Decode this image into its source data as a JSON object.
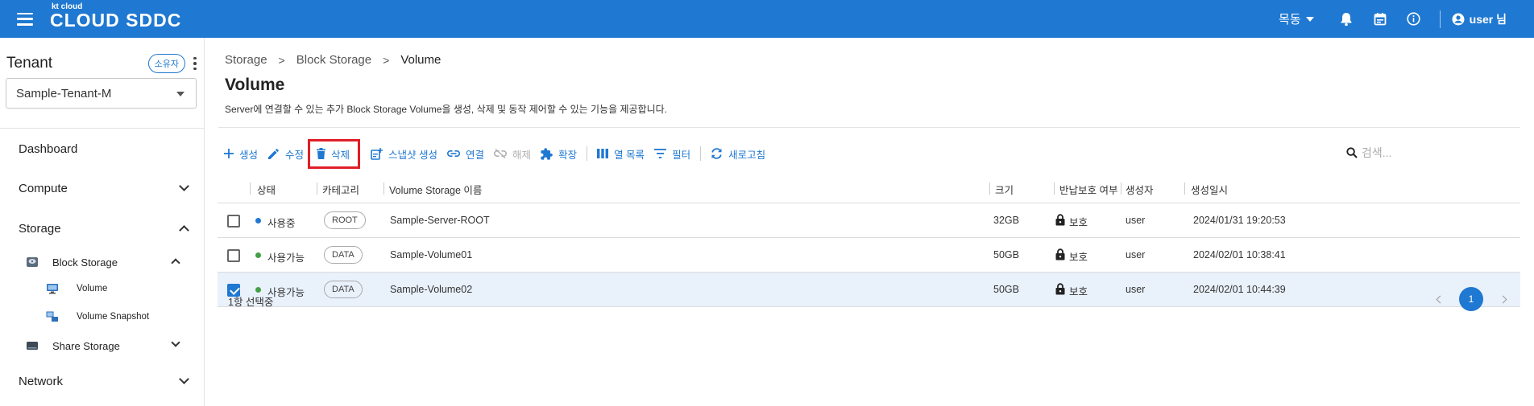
{
  "header": {
    "logo_small": "kt cloud",
    "logo_main": "CLOUD SDDC",
    "lang": "목동",
    "user": "user 님"
  },
  "sidebar": {
    "tenant_title": "Tenant",
    "owner_badge": "소유자",
    "tenant_select": "Sample-Tenant-M",
    "items": {
      "dashboard": "Dashboard",
      "compute": "Compute",
      "storage": "Storage",
      "block_storage": "Block Storage",
      "volume": "Volume",
      "volume_snapshot": "Volume Snapshot",
      "share_storage": "Share Storage",
      "network": "Network"
    }
  },
  "breadcrumb": {
    "items": [
      "Storage",
      "Block Storage",
      "Volume"
    ]
  },
  "page": {
    "title": "Volume",
    "description": "Server에 연결할 수 있는 추가 Block Storage Volume을 생성, 삭제 및 동작 제어할 수 있는 기능을 제공합니다."
  },
  "toolbar": {
    "create": "생성",
    "edit": "수정",
    "delete": "삭제",
    "snapshot": "스냅샷 생성",
    "connect": "연결",
    "disconnect": "해제",
    "extend": "확장",
    "columns": "열 목록",
    "filter": "필터",
    "refresh": "새로고침",
    "search_placeholder": "검색..."
  },
  "table": {
    "headers": {
      "status": "상태",
      "category": "카테고리",
      "name": "Volume Storage 이름",
      "size": "크기",
      "protect": "반납보호 여부",
      "creator": "생성자",
      "created": "생성일시"
    },
    "rows": [
      {
        "status": "사용중",
        "status_color": "#1f78d1",
        "category": "ROOT",
        "name": "Sample-Server-ROOT",
        "size": "32GB",
        "protect": "보호",
        "creator": "user",
        "created": "2024/01/31 19:20:53",
        "checked": false
      },
      {
        "status": "사용가능",
        "status_color": "#43a047",
        "category": "DATA",
        "name": "Sample-Volume01",
        "size": "50GB",
        "protect": "보호",
        "creator": "user",
        "created": "2024/02/01 10:38:41",
        "checked": false
      },
      {
        "status": "사용가능",
        "status_color": "#43a047",
        "category": "DATA",
        "name": "Sample-Volume02",
        "size": "50GB",
        "protect": "보호",
        "creator": "user",
        "created": "2024/02/01 10:44:39",
        "checked": true
      }
    ]
  },
  "footer": {
    "selected": "1항 선택중",
    "page": "1"
  },
  "colors": {
    "brand": "#1f78d1",
    "highlight": "#e01e26"
  }
}
